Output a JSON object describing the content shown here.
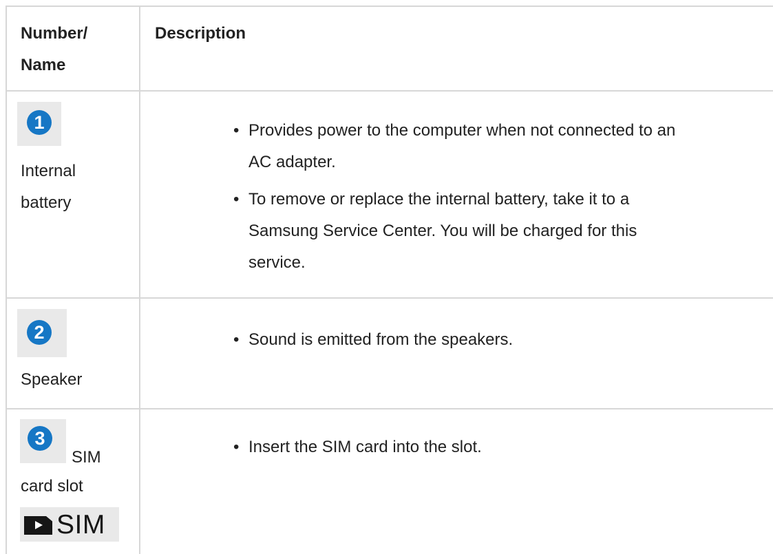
{
  "table": {
    "header": {
      "col1": [
        "Number/",
        "Name"
      ],
      "col2": "Description"
    },
    "rows": [
      {
        "number": "1",
        "name": [
          "Internal",
          "battery"
        ],
        "bullets": [
          [
            "Provides power to the computer when not connected to an",
            "AC adapter."
          ],
          [
            "To remove or replace the internal battery, take it to a",
            "Samsung Service Center. You will be charged for this",
            "service."
          ]
        ]
      },
      {
        "number": "2",
        "name": [
          "Speaker"
        ],
        "bullets": [
          [
            "Sound is emitted from the speakers."
          ]
        ]
      },
      {
        "number": "3",
        "name": [
          "SIM",
          "card slot"
        ],
        "sim_label": "SIM",
        "sim_icon": "sim-card-icon",
        "bullets": [
          [
            "Insert the SIM card into the slot."
          ]
        ]
      }
    ],
    "colors": {
      "badge": "#1677c5",
      "border": "#d7d7d7",
      "badge_bg": "#e9e9e9",
      "text": "#222222"
    }
  }
}
